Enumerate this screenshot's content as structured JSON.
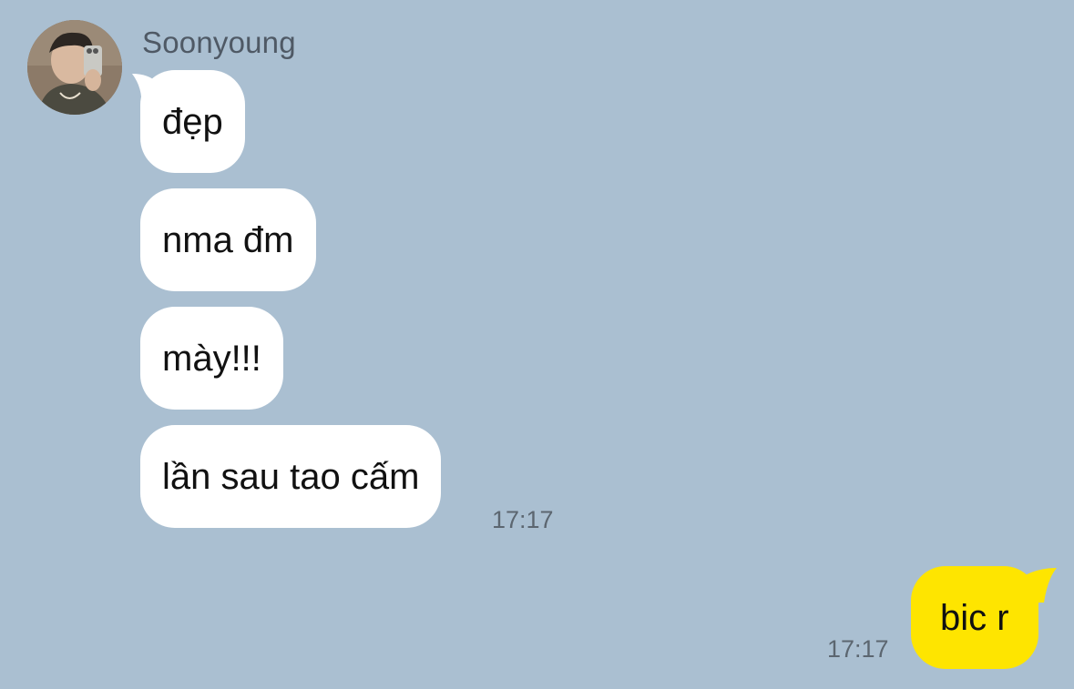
{
  "contact": {
    "name": "Soonyoung"
  },
  "messages_in": [
    {
      "text": "đẹp"
    },
    {
      "text": "nma đm"
    },
    {
      "text": "mày!!!"
    },
    {
      "text": "lần sau tao cấm"
    }
  ],
  "messages_in_time": "17:17",
  "message_out": {
    "text": "bic r",
    "time": "17:17"
  },
  "colors": {
    "background": "#aabfd1",
    "incoming_bubble": "#ffffff",
    "outgoing_bubble": "#fee500"
  },
  "icons": {
    "avatar": "profile-photo"
  }
}
